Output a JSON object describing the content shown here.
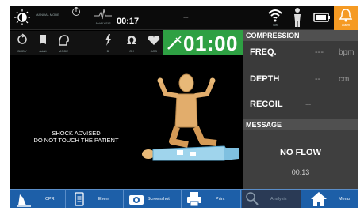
{
  "topbar": {
    "mode_small_label": "MANUAL MODE",
    "timer_small": "00:17",
    "ecg_label": "ANALYSIS",
    "dash": "--",
    "wifi_label": "wifi",
    "alarm_label": "alarm"
  },
  "row2": {
    "icons": [
      {
        "label": "BODY"
      },
      {
        "label": "Adult"
      },
      {
        "label": "MODE"
      },
      {
        "label": "B"
      },
      {
        "label": "OK"
      },
      {
        "label": "ACD"
      }
    ],
    "timer": "01:00"
  },
  "compression": {
    "title": "COMPRESSION",
    "freq_label": "FREQ.",
    "freq_value": "---",
    "freq_unit": "bpm",
    "depth_label": "DEPTH",
    "depth_value": "--",
    "depth_unit": "cm",
    "recoil_label": "RECOIL",
    "recoil_value": "--"
  },
  "message": {
    "title": "MESSAGE",
    "text": "NO FLOW",
    "time": "00:13"
  },
  "shock": {
    "line1": "SHOCK ADVISED",
    "line2": "DO NOT TOUCH THE PATIENT"
  },
  "bottom": {
    "cpr": "CPR",
    "event": "Event",
    "screenshot": "Screenshot",
    "print": "Print",
    "analysis": "Analysis",
    "menu": "Menu"
  },
  "colors": {
    "accent_green": "#2ea043",
    "accent_orange": "#f59a23",
    "nav_blue": "#1d5fa8",
    "panel_gray": "#3a3a3a"
  }
}
